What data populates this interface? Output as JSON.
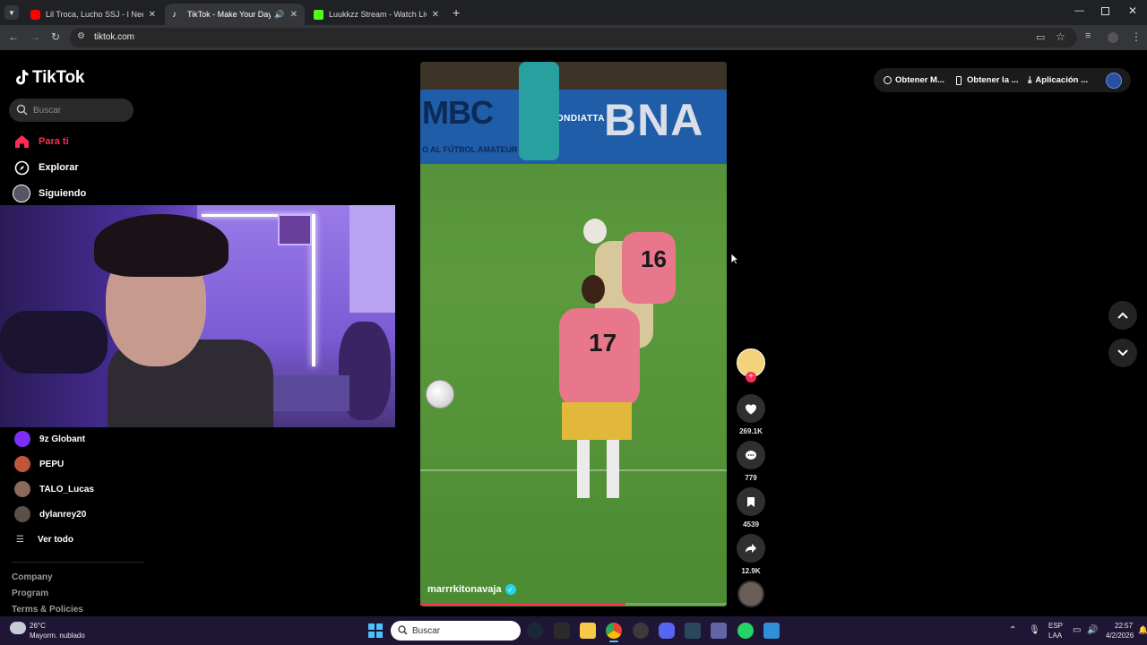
{
  "browser": {
    "tabs": [
      {
        "title": "Lil Troca, Lucho SSJ - I Need Yo",
        "favicon": "youtube-icon",
        "active": false
      },
      {
        "title": "TikTok - Make Your Day",
        "favicon": "tiktok-icon",
        "active": true
      },
      {
        "title": "Luukkzz Stream - Watch Live o",
        "favicon": "kick-icon",
        "active": false
      }
    ],
    "url": "tiktok.com"
  },
  "sidebar": {
    "logo": "TikTok",
    "search_placeholder": "Buscar",
    "nav": [
      {
        "label": "Para ti",
        "icon": "home-icon",
        "active": true
      },
      {
        "label": "Explorar",
        "icon": "compass-icon",
        "active": false
      },
      {
        "label": "Siguiendo",
        "icon": "following-avatar-icon",
        "active": false
      }
    ],
    "following": [
      {
        "name": "9z Globant"
      },
      {
        "name": "PEPU"
      },
      {
        "name": "TALO_Lucas"
      },
      {
        "name": "dylanrey20"
      }
    ],
    "see_all": "Ver todo",
    "footer": [
      "Company",
      "Program",
      "Terms & Policies"
    ]
  },
  "video": {
    "banner_text": "LA FONDIATTA",
    "banner_left": "MBC",
    "banner_sub": "O AL FÚTBOL AMATEUR",
    "banner_right": "BNA",
    "player_number_1": "17",
    "player_number_2": "16",
    "author": "marrrkitonavaja",
    "verified": true,
    "progress": 0.67
  },
  "actions": {
    "likes": "269.1K",
    "comments": "779",
    "saves": "4539",
    "shares": "12.9K"
  },
  "topbar": {
    "items": [
      "Obtener M...",
      "Obtener la ...",
      "Aplicación ..."
    ]
  },
  "taskbar": {
    "weather_temp": "26°C",
    "weather_desc": "Mayorm. nublado",
    "search_placeholder": "Buscar",
    "lang_top": "ESP",
    "lang_bottom": "LAA",
    "time": "22:57",
    "date": "4/2/2026"
  },
  "colors": {
    "accent": "#fe2c55",
    "chrome_bg": "#202124",
    "taskbar_bg": "#1f1635",
    "webcam_purple": "#7b54d6"
  }
}
